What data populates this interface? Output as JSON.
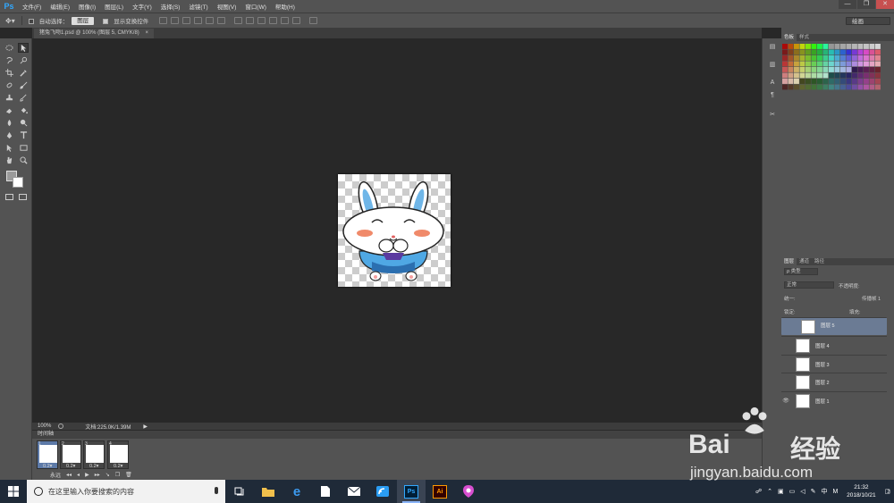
{
  "app": {
    "logo": "Ps"
  },
  "menu": [
    "文件(F)",
    "编辑(E)",
    "图像(I)",
    "图层(L)",
    "文字(Y)",
    "选择(S)",
    "滤镜(T)",
    "视图(V)",
    "窗口(W)",
    "帮助(H)"
  ],
  "window_controls": {
    "minimize": "—",
    "restore": "❐",
    "close": "✕"
  },
  "options_bar": {
    "auto_select_label": "自动选择：",
    "auto_select_value": "图层",
    "show_transform_label": "显示变换控件",
    "workspace_value": "绘画"
  },
  "document_tab": {
    "title": "猪兔飞吻1.psd @ 100% (图层 5, CMYK/8)",
    "close": "×"
  },
  "status": {
    "zoom": "100%",
    "doc": "文档:225.0K/1.39M"
  },
  "timeline": {
    "title": "时间轴",
    "frames": [
      {
        "num": "1",
        "delay": "0.2▾"
      },
      {
        "num": "2",
        "delay": "0.2▾"
      },
      {
        "num": "3",
        "delay": "0.2▾"
      },
      {
        "num": "4",
        "delay": "0.2▾"
      }
    ],
    "loop": "永远"
  },
  "swatches": {
    "tabs": [
      "色板",
      "样式"
    ]
  },
  "layers": {
    "tabs": [
      "图层",
      "通道",
      "路径"
    ],
    "filter_label": "ρ 类型",
    "blend_mode": "正常",
    "opacity_label": "不透明度:",
    "unify_label": "统一:",
    "propagate_label": "传播帧 1",
    "lock_label": "锁定:",
    "fill_label": "填充:",
    "rows": [
      {
        "name": "图层 5",
        "selected": true,
        "visible": false
      },
      {
        "name": "图层 4",
        "selected": false,
        "visible": false
      },
      {
        "name": "图层 3",
        "selected": false,
        "visible": false
      },
      {
        "name": "图层 2",
        "selected": false,
        "visible": false
      },
      {
        "name": "图层 1",
        "selected": false,
        "visible": true
      }
    ]
  },
  "taskbar": {
    "search_placeholder": "在这里输入你要搜索的内容",
    "time": "21:32",
    "date": "2018/10/21",
    "ime": "M",
    "notifications": "2"
  },
  "watermark": {
    "brand": "Bai",
    "brand2": "百度",
    "word": "经验",
    "url": "jingyan.baidu.com"
  }
}
